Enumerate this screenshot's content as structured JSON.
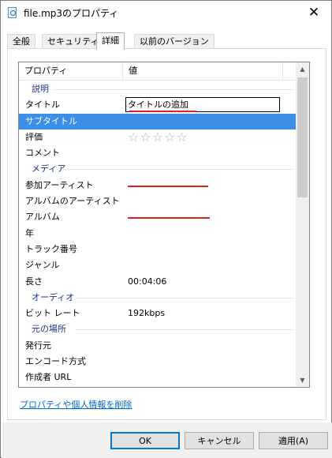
{
  "window": {
    "title": "file.mp3のプロパティ",
    "close_glyph": "✕"
  },
  "tabs": [
    {
      "label": "全般"
    },
    {
      "label": "セキュリティ"
    },
    {
      "label": "詳細"
    },
    {
      "label": "以前のバージョン"
    }
  ],
  "list": {
    "headers": {
      "property": "プロパティ",
      "value": "値"
    },
    "groups": {
      "description": "説明",
      "media": "メディア",
      "audio": "オーディオ",
      "origin": "元の場所"
    },
    "rows": {
      "title": {
        "name": "タイトル",
        "value": "タイトルの追加"
      },
      "subtitle": {
        "name": "サブタイトル",
        "value": ""
      },
      "rating": {
        "name": "評価",
        "value": "☆☆☆☆☆"
      },
      "comment": {
        "name": "コメント",
        "value": ""
      },
      "contributing_artist": {
        "name": "参加アーティスト",
        "value": ""
      },
      "album_artist": {
        "name": "アルバムのアーティスト",
        "value": ""
      },
      "album": {
        "name": "アルバム",
        "value": ""
      },
      "year": {
        "name": "年",
        "value": ""
      },
      "track": {
        "name": "トラック番号",
        "value": ""
      },
      "genre": {
        "name": "ジャンル",
        "value": ""
      },
      "length": {
        "name": "長さ",
        "value": "00:04:06"
      },
      "bitrate": {
        "name": "ビット レート",
        "value": "192kbps"
      },
      "publisher": {
        "name": "発行元",
        "value": ""
      },
      "encoded_by": {
        "name": "エンコード方式",
        "value": ""
      },
      "author_url": {
        "name": "作成者 URL",
        "value": ""
      }
    }
  },
  "link": {
    "label": "プロパティや個人情報を削除"
  },
  "buttons": {
    "ok": "OK",
    "cancel": "キャンセル",
    "apply": "適用(A)"
  },
  "colors": {
    "selection": "#3d8ee8",
    "group_header": "#1e3287",
    "annotation_red": "#e0201a",
    "link": "#0066cc"
  }
}
